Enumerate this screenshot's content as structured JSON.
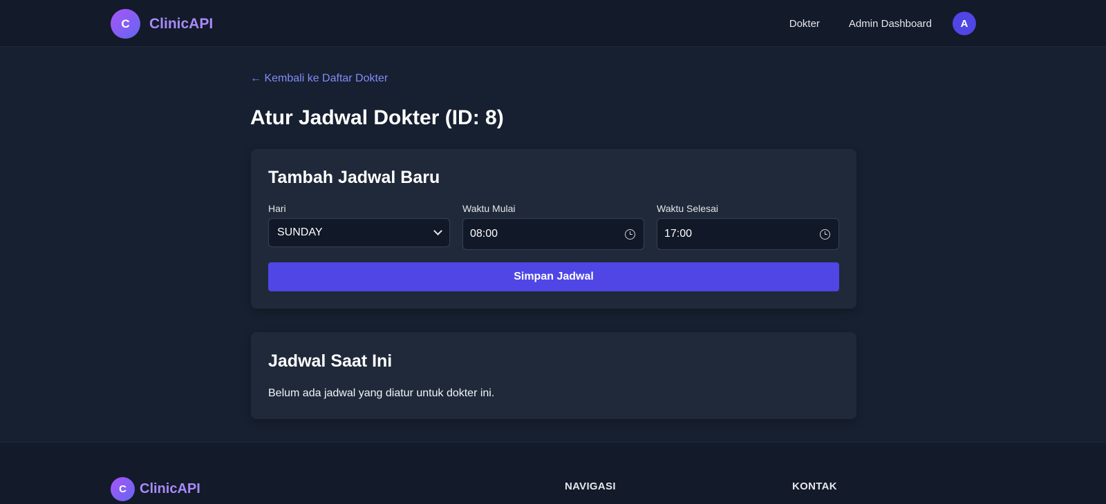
{
  "header": {
    "logo_letter": "C",
    "brand": "ClinicAPI",
    "nav": [
      "Dokter",
      "Admin Dashboard"
    ],
    "avatar_letter": "A"
  },
  "main": {
    "back_link": "← Kembali ke Daftar Dokter",
    "title": "Atur Jadwal Dokter (ID: 8)",
    "add_card": {
      "title": "Tambah Jadwal Baru",
      "day_label": "Hari",
      "day_value": "SUNDAY",
      "start_label": "Waktu Mulai",
      "start_value": "08:00",
      "end_label": "Waktu Selesai",
      "end_value": "17:00",
      "save_label": "Simpan Jadwal"
    },
    "list_card": {
      "title": "Jadwal Saat Ini",
      "empty_text": "Belum ada jadwal yang diatur untuk dokter ini."
    }
  },
  "footer": {
    "logo_letter": "C",
    "brand": "ClinicAPI",
    "nav_heading": "NAVIGASI",
    "contact_heading": "KONTAK"
  },
  "colors": {
    "background": "#172030",
    "header": "#131a2a",
    "card": "#1f2939",
    "accent": "#4f46e5",
    "link": "#818cf8",
    "brand": "#a78bfa"
  }
}
